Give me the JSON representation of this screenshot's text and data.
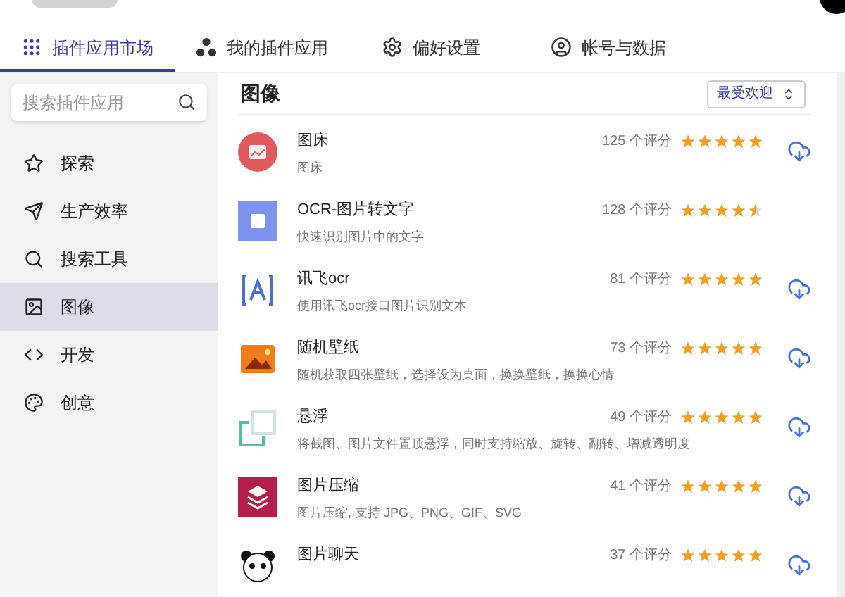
{
  "tabs": [
    {
      "label": "插件应用市场",
      "selected": true
    },
    {
      "label": "我的插件应用",
      "selected": false
    },
    {
      "label": "偏好设置",
      "selected": false
    },
    {
      "label": "帐号与数据",
      "selected": false
    }
  ],
  "search": {
    "placeholder": "搜索插件应用"
  },
  "sidebar": {
    "items": [
      {
        "label": "探索",
        "selected": false
      },
      {
        "label": "生产效率",
        "selected": false
      },
      {
        "label": "搜索工具",
        "selected": false
      },
      {
        "label": "图像",
        "selected": true
      },
      {
        "label": "开发",
        "selected": false
      },
      {
        "label": "创意",
        "selected": false
      }
    ]
  },
  "content": {
    "title": "图像",
    "sort": "最受欢迎",
    "apps": [
      {
        "name": "图床",
        "description": "图床",
        "ratings": "125 个评分",
        "stars": 5,
        "installed": false
      },
      {
        "name": "OCR-图片转文字",
        "description": "快速识别图片中的文字",
        "ratings": "128 个评分",
        "stars": 4.5,
        "installed": true
      },
      {
        "name": "讯飞ocr",
        "description": "使用讯飞ocr接口图片识别文本",
        "ratings": "81 个评分",
        "stars": 5,
        "installed": false
      },
      {
        "name": "随机壁纸",
        "description": "随机获取四张壁纸，选择设为桌面，换换壁纸，换换心情",
        "ratings": "73 个评分",
        "stars": 5,
        "installed": false
      },
      {
        "name": "悬浮",
        "description": "将截图、图片文件置顶悬浮，同时支持缩放、旋转、翻转、增减透明度",
        "ratings": "49 个评分",
        "stars": 5,
        "installed": false
      },
      {
        "name": "图片压缩",
        "description": "图片压缩, 支持 JPG、PNG、GIF、SVG",
        "ratings": "41 个评分",
        "stars": 5,
        "installed": false
      },
      {
        "name": "图片聊天",
        "ratings": "37 个评分",
        "stars": 5,
        "installed": false
      }
    ]
  }
}
